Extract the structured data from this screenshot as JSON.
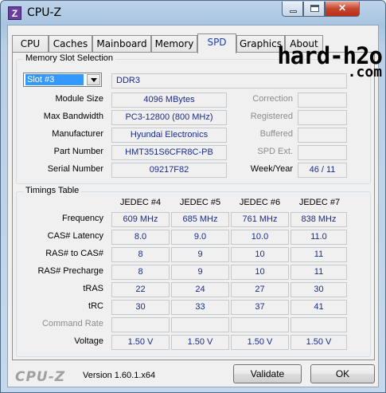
{
  "window": {
    "title": "CPU-Z",
    "icon_letter": "Z"
  },
  "tabs": [
    "CPU",
    "Caches",
    "Mainboard",
    "Memory",
    "SPD",
    "Graphics",
    "About"
  ],
  "active_tab": "SPD",
  "watermark": {
    "line1": "hard-h2o",
    "line2": ".com"
  },
  "memory_slot_selection": {
    "legend": "Memory Slot Selection",
    "slot_value": "Slot #3",
    "type": "DDR3",
    "rows": [
      {
        "label": "Module Size",
        "value": "4096 MBytes",
        "right_label": "Correction",
        "right_value": ""
      },
      {
        "label": "Max Bandwidth",
        "value": "PC3-12800 (800 MHz)",
        "right_label": "Registered",
        "right_value": ""
      },
      {
        "label": "Manufacturer",
        "value": "Hyundai Electronics",
        "right_label": "Buffered",
        "right_value": ""
      },
      {
        "label": "Part Number",
        "value": "HMT351S6CFR8C-PB",
        "right_label": "SPD Ext.",
        "right_value": ""
      },
      {
        "label": "Serial Number",
        "value": "09217F82",
        "right_label": "Week/Year",
        "right_value": "46 / 11"
      }
    ]
  },
  "timings_table": {
    "legend": "Timings Table",
    "columns": [
      "JEDEC #4",
      "JEDEC #5",
      "JEDEC #6",
      "JEDEC #7"
    ],
    "rows": [
      {
        "label": "Frequency",
        "values": [
          "609 MHz",
          "685 MHz",
          "761 MHz",
          "838 MHz"
        ]
      },
      {
        "label": "CAS# Latency",
        "values": [
          "8.0",
          "9.0",
          "10.0",
          "11.0"
        ]
      },
      {
        "label": "RAS# to CAS#",
        "values": [
          "8",
          "9",
          "10",
          "11"
        ]
      },
      {
        "label": "RAS# Precharge",
        "values": [
          "8",
          "9",
          "10",
          "11"
        ]
      },
      {
        "label": "tRAS",
        "values": [
          "22",
          "24",
          "27",
          "30"
        ]
      },
      {
        "label": "tRC",
        "values": [
          "30",
          "33",
          "37",
          "41"
        ]
      },
      {
        "label": "Command Rate",
        "values": [
          "",
          "",
          "",
          ""
        ]
      },
      {
        "label": "Voltage",
        "values": [
          "1.50 V",
          "1.50 V",
          "1.50 V",
          "1.50 V"
        ]
      }
    ]
  },
  "footer": {
    "brand": "CPU-Z",
    "version": "Version 1.60.1.x64",
    "validate_label": "Validate",
    "ok_label": "OK"
  }
}
